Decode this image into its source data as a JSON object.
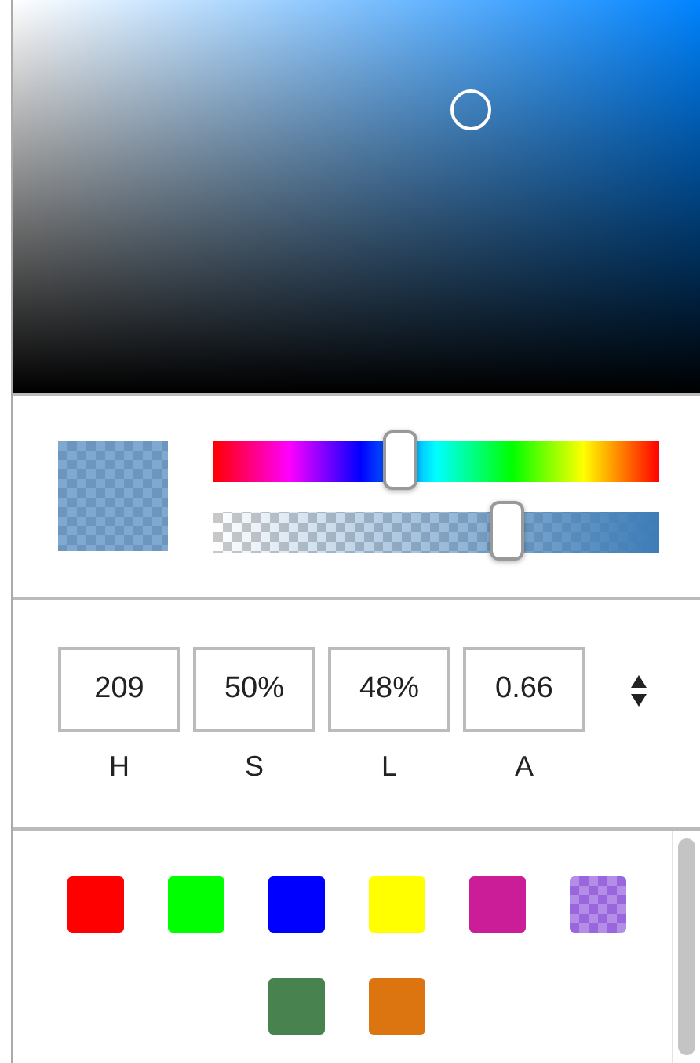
{
  "hue_slider": {
    "level": 0.42
  },
  "alpha_slider": {
    "level": 0.66
  },
  "inputs": [
    {
      "value": "209",
      "label": "H"
    },
    {
      "value": "50%",
      "label": "S"
    },
    {
      "value": "48%",
      "label": "L"
    },
    {
      "value": "0.66",
      "label": "A"
    }
  ],
  "swatches": [
    {
      "kind": "solid",
      "color": "#ff0000"
    },
    {
      "kind": "solid",
      "color": "#00ff00"
    },
    {
      "kind": "solid",
      "color": "#0000ff"
    },
    {
      "kind": "solid",
      "color": "#ffff00"
    },
    {
      "kind": "solid",
      "color": "#cc1d99"
    },
    {
      "kind": "translucent",
      "color": "#9966dd"
    },
    {
      "kind": "solid",
      "color": "#48834f"
    },
    {
      "kind": "solid",
      "color": "#dc7510"
    }
  ]
}
